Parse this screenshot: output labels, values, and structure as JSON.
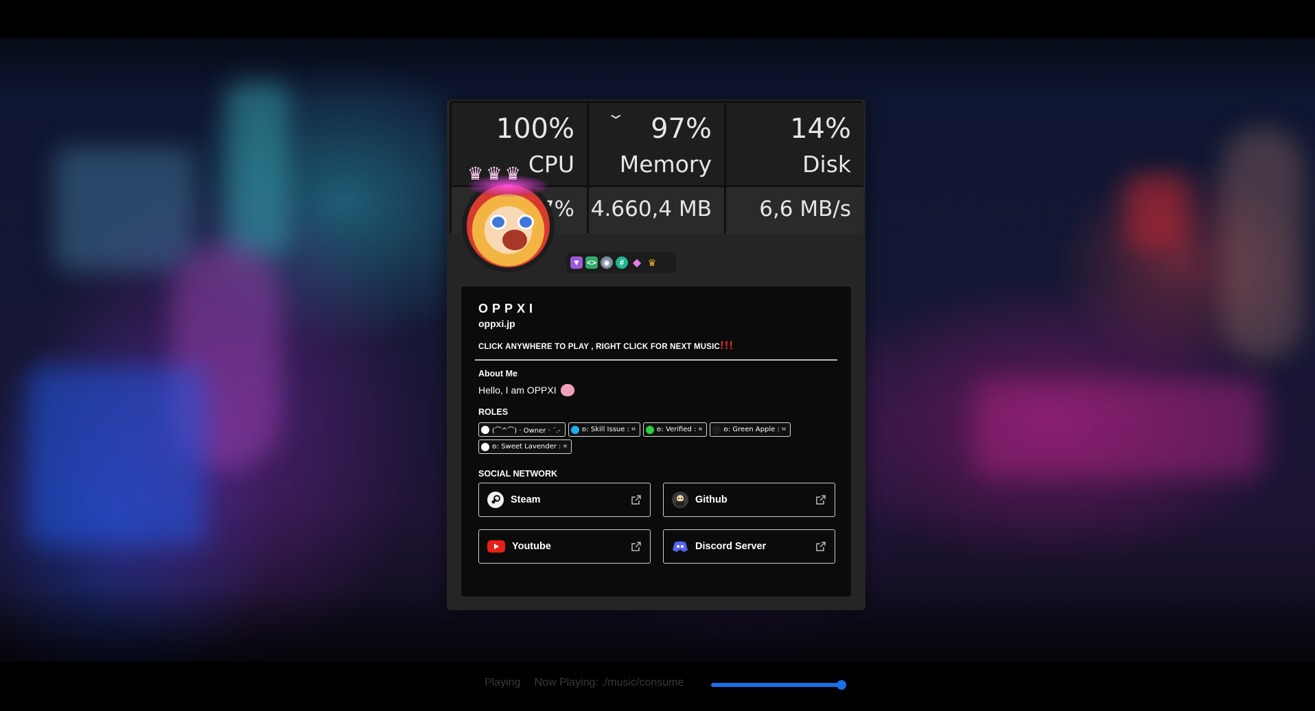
{
  "performance": {
    "cpu": {
      "value": "100%",
      "label": "CPU",
      "sub": "7%"
    },
    "memory": {
      "value": "97%",
      "label": "Memory",
      "sub": "4.660,4 MB"
    },
    "disk": {
      "value": "14%",
      "label": "Disk",
      "sub": "6,6 MB/s"
    }
  },
  "profile": {
    "name": "OPPXI",
    "handle": "oppxi.jp",
    "tagline": "CLICK ANYWHERE TO PLAY , RIGHT CLICK FOR NEXT MUSIC",
    "tagline_emphasis": "!!!",
    "about_title": "About Me",
    "about_text": "Hello, I am OPPXI",
    "roles_title": "ROLES",
    "roles": [
      {
        "label": "(⌒^⌒)  · Owner · ´.-",
        "color": "#ffffff"
      },
      {
        "label": "ʚ: Skill Issue : ⌗",
        "color": "#1ab0e8"
      },
      {
        "label": "ʚ: Verified : ⌗",
        "color": "#2ecc40"
      },
      {
        "label": "ʚ: Green Apple : ⌗",
        "color": "#1f1f1f"
      },
      {
        "label": "ʚ: Sweet Lavender : ⌗",
        "color": "#ffffff"
      }
    ],
    "social_title": "SOCIAL NETWORK",
    "social": [
      {
        "label": "Steam",
        "icon": "steam-icon"
      },
      {
        "label": "Github",
        "icon": "github-icon"
      },
      {
        "label": "Youtube",
        "icon": "youtube-icon"
      },
      {
        "label": "Discord Server",
        "icon": "discord-icon"
      }
    ],
    "badges": [
      "hypesquad-icon",
      "active-developer-icon",
      "nitro-boost-icon",
      "hashtag-icon",
      "gem-icon",
      "crown-icon"
    ]
  },
  "player": {
    "status": "Playing",
    "now_playing": "Now Playing: ./music/consume",
    "volume": 1.0
  },
  "colors": {
    "accent": "#1a6ee8",
    "panel": "#0b0b0b",
    "card": "#252525",
    "emphasis": "#e0302a"
  }
}
